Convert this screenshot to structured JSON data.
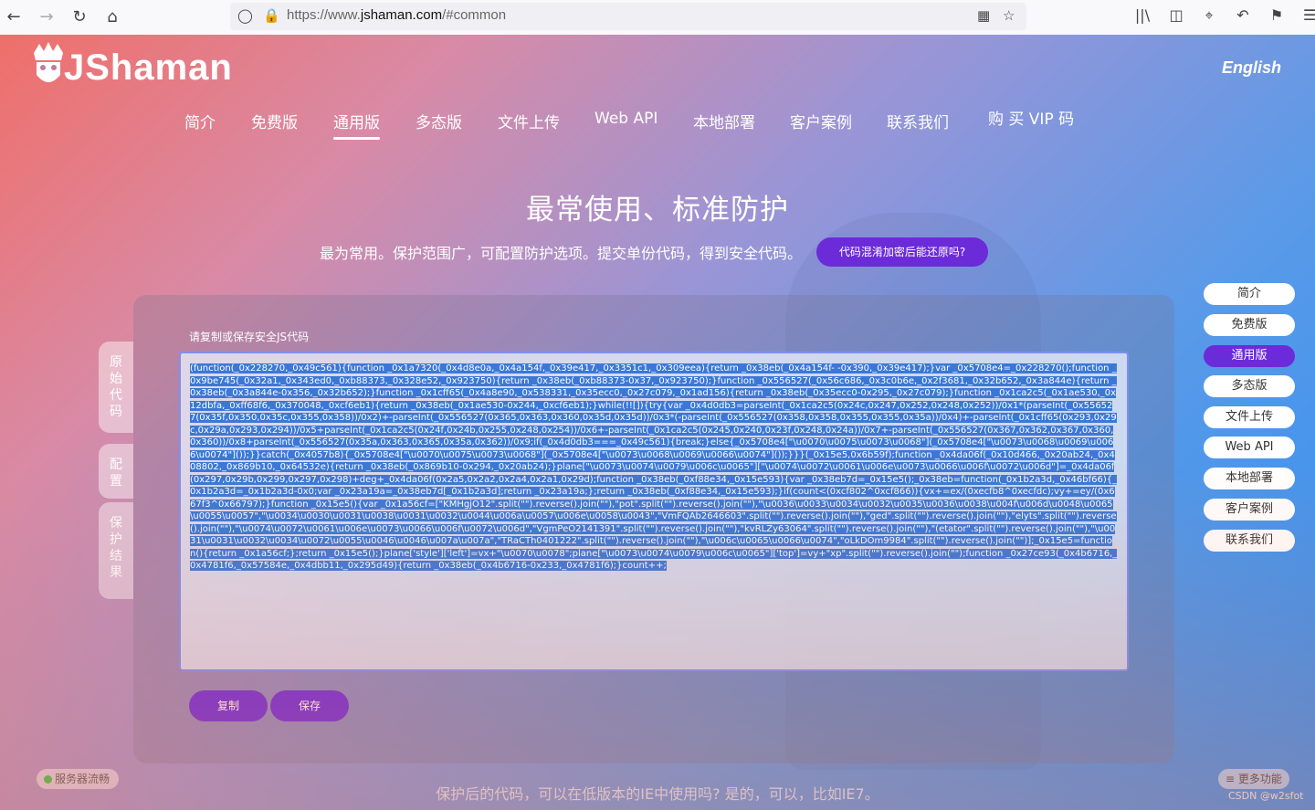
{
  "browser": {
    "url_prefix": "https://www.",
    "url_domain": "jshaman.com",
    "url_suffix": "/#common"
  },
  "site": {
    "logo_text": "JShaman",
    "language": "English",
    "nav": [
      "简介",
      "免费版",
      "通用版",
      "多态版",
      "文件上传",
      "Web API",
      "本地部署",
      "客户案例",
      "联系我们",
      "购 买 VIP 码"
    ],
    "active_nav": "通用版"
  },
  "hero": {
    "title": "最常使用、标准防护",
    "subtitle": "最为常用。保护范围广，可配置防护选项。提交单份代码，得到安全代码。",
    "question_button": "代码混淆加密后能还原吗?"
  },
  "panel": {
    "side_tabs": [
      "原始代码",
      "配置",
      "保护结果"
    ],
    "label": "请复制或保存安全JS代码",
    "code": "(function(_0x228270,_0x49c561){function _0x1a7320(_0x4d8e0a,_0x4a154f,_0x39e417,_0x3351c1,_0x309eea){return _0x38eb(_0x4a154f- -0x390,_0x39e417);}var _0x5708e4=_0x228270();function _0x9be745(_0x32a1,_0x343ed0,_0xb88373,_0x328e52,_0x923750){return _0x38eb(_0xb88373-0x37,_0x923750);}function _0x556527(_0x56c686,_0x3c0b6e,_0x2f3681,_0x32b652,_0x3a844e){return _0x38eb(_0x3a844e-0x356,_0x32b652);}function _0x1cff65(_0x4a8e90,_0x538331,_0x35ecc0,_0x27c079,_0x1ad156){return _0x38eb(_0x35ecc0-0x295,_0x27c079);}function _0x1ca2c5(_0x1ae530,_0x12dbfa,_0xff68f6,_0x370048,_0xcf6eb1){return _0x38eb(_0x1ae530-0x244,_0xcf6eb1);}while(!![]){try{var _0x4d0db3=parseInt(_0x1ca2c5(0x24c,0x247,0x252,0x248,0x252))/0x1*(parseInt(_0x556527(0x35f,0x350,0x35c,0x355,0x358))/0x2)+-parseInt(_0x556527(0x365,0x363,0x360,0x35d,0x35d))/0x3*(-parseInt(_0x556527(0x358,0x358,0x355,0x355,0x35a))/0x4)+-parseInt(_0x1cff65(0x293,0x29c,0x29a,0x293,0x294))/0x5+parseInt(_0x1ca2c5(0x24f,0x24b,0x255,0x248,0x254))/0x6+-parseInt(_0x1ca2c5(0x245,0x240,0x23f,0x248,0x24a))/0x7+-parseInt(_0x556527(0x367,0x362,0x367,0x360,0x360))/0x8+parseInt(_0x556527(0x35a,0x363,0x365,0x35a,0x362))/0x9;if(_0x4d0db3===_0x49c561){break;}else{_0x5708e4[\"\\u0070\\u0075\\u0073\\u0068\"](_0x5708e4[\"\\u0073\\u0068\\u0069\\u0066\\u0074\"]());}}catch(_0x4057b8){_0x5708e4[\"\\u0070\\u0075\\u0073\\u0068\"](_0x5708e4[\"\\u0073\\u0068\\u0069\\u0066\\u0074\"]());}}}(_0x15e5,0x6b59f);function _0x4da06f(_0x10d466,_0x20ab24,_0x408802,_0x869b10,_0x64532e){return _0x38eb(_0x869b10-0x294,_0x20ab24);}plane[\"\\u0073\\u0074\\u0079\\u006c\\u0065\"][\"\\u0074\\u0072\\u0061\\u006e\\u0073\\u0066\\u006f\\u0072\\u006d\"]=_0x4da06f(0x297,0x29b,0x299,0x297,0x298)+deg+_0x4da06f(0x2a5,0x2a2,0x2a4,0x2a1,0x29d);function _0x38eb(_0xf88e34,_0x15e593){var _0x38eb7d=_0x15e5();_0x38eb=function(_0x1b2a3d,_0x46bf66){_0x1b2a3d=_0x1b2a3d-0x0;var _0x23a19a=_0x38eb7d[_0x1b2a3d];return _0x23a19a;};return _0x38eb(_0xf88e34,_0x15e593);}if(count<(0xcf802^0xcf866)){vx+=ex/(0xecfb8^0xecfdc);vy+=ey/(0x667f3^0x66797);}function _0x15e5(){var _0x1a56cf=[\"KMHgjO12\".split(\"\").reverse().join(\"\"),\"pot\".split(\"\").reverse().join(\"\"),\"\\u0036\\u0033\\u0034\\u0032\\u0035\\u0036\\u0038\\u004f\\u006d\\u0048\\u0065\\u0055\\u0057\",\"\\u0034\\u0030\\u0031\\u0038\\u0031\\u0032\\u0044\\u006a\\u0057\\u006e\\u0058\\u0043\",\"VmFQAb2646603\".split(\"\").reverse().join(\"\"),\"ged\".split(\"\").reverse().join(\"\"),\"elyts\".split(\"\").reverse().join(\"\"),\"\\u0074\\u0072\\u0061\\u006e\\u0073\\u0066\\u006f\\u0072\\u006d\",\"VgmPeO2141391\".split(\"\").reverse().join(\"\"),\"kvRLZy63064\".split(\"\").reverse().join(\"\"),\"(etator\".split(\"\").reverse().join(\"\"),\"\\u0031\\u0031\\u0032\\u0034\\u0072\\u0055\\u0046\\u0046\\u007a\\u007a\",\"TRaCTh0401222\".split(\"\").reverse().join(\"\"),\"\\u006c\\u0065\\u0066\\u0074\",\"oLkDOm9984\".split(\"\").reverse().join(\"\")];_0x15e5=function(){return _0x1a56cf;};return _0x15e5();}plane['style']['left']=vx+\"\\u0070\\u0078\";plane[\"\\u0073\\u0074\\u0079\\u006c\\u0065\"]['top']=vy+\"xp\".split(\"\").reverse().join(\"\");function _0x27ce93(_0x4b6716,_0x4781f6,_0x57584e,_0x4dbb11,_0x295d49){return _0x38eb(_0x4b6716-0x233,_0x4781f6);}count++;",
    "copy_button": "复制",
    "save_button": "保存"
  },
  "right_nav": [
    "简介",
    "免费版",
    "通用版",
    "多态版",
    "文件上传",
    "Web API",
    "本地部署",
    "客户案例",
    "联系我们"
  ],
  "right_nav_active": "通用版",
  "footer": {
    "status": "服务器流畅",
    "more": "≡ 更多功能",
    "question": "保护后的代码，可以在低版本的IE中使用吗? 是的，可以，比如IE7。",
    "watermark": "CSDN @w2sfot"
  },
  "colors": {
    "accent": "#6c2bd9",
    "selection": "#3b78d6",
    "status_green": "#3ec14b"
  }
}
